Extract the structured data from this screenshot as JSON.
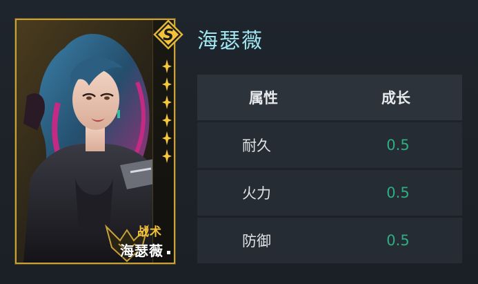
{
  "hero": {
    "name": "海瑟薇"
  },
  "card": {
    "rank": "S",
    "star_count": 6,
    "role": "战术",
    "name": "海瑟薇",
    "colors": {
      "frame": "#c8a23a",
      "role_text": "#f2c23a",
      "hair": "#2e5a7a"
    }
  },
  "stats": {
    "headers": {
      "attribute": "属性",
      "growth": "成长"
    },
    "rows": [
      {
        "attribute": "耐久",
        "growth": "0.5"
      },
      {
        "attribute": "火力",
        "growth": "0.5"
      },
      {
        "attribute": "防御",
        "growth": "0.5"
      }
    ],
    "colors": {
      "growth_value": "#2fae84",
      "title": "#9fe6f2"
    }
  }
}
